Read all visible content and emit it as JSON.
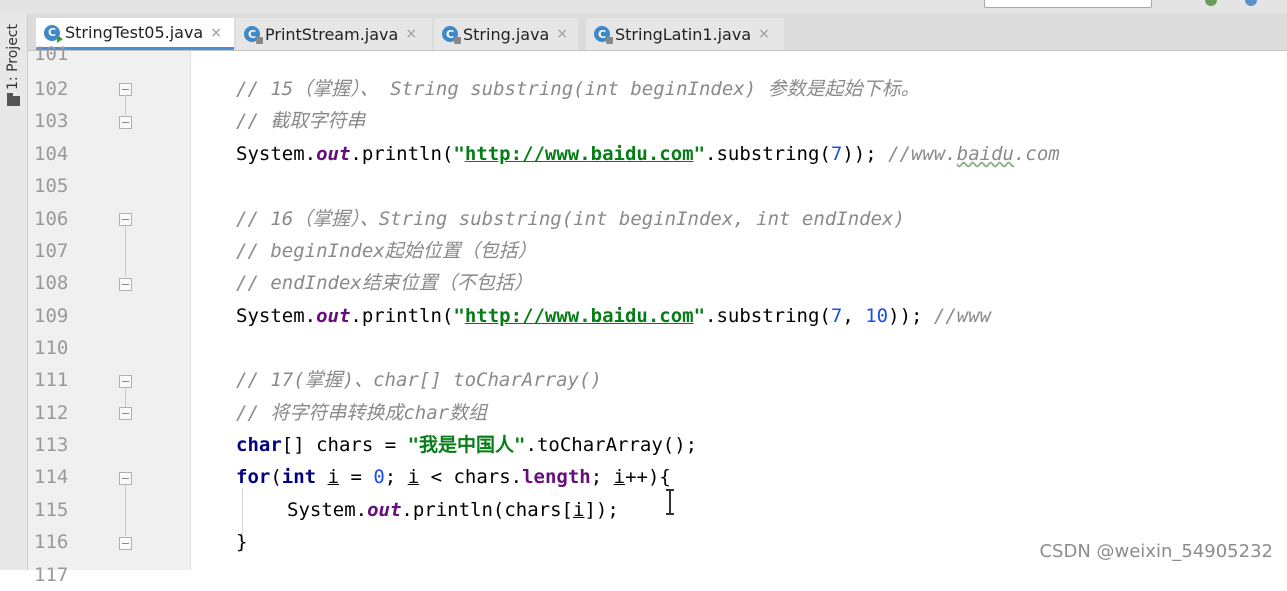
{
  "tool_window": {
    "project_label": "1: Project"
  },
  "tabs": [
    {
      "label": "StringTest05.java",
      "icon": "java-class-runnable-icon",
      "active": true
    },
    {
      "label": "PrintStream.java",
      "icon": "java-class-library-icon",
      "active": false
    },
    {
      "label": "String.java",
      "icon": "java-class-library-icon",
      "active": false
    },
    {
      "label": "StringLatin1.java",
      "icon": "java-class-library-icon",
      "active": false
    }
  ],
  "tab_close_glyph": "×",
  "line_numbers": [
    "101",
    "102",
    "103",
    "104",
    "105",
    "106",
    "107",
    "108",
    "109",
    "110",
    "111",
    "112",
    "113",
    "114",
    "115",
    "116",
    "117"
  ],
  "code": {
    "l102": "// 15（掌握）、 String substring(int beginIndex) 参数是起始下标。",
    "l103": "// 截取字符串",
    "l104": {
      "a": "System.",
      "b": "out",
      "c": ".println(",
      "d": "\"",
      "e": "http://www.baidu.com",
      "f": "\"",
      "g": ".substring(",
      "h": "7",
      "i": ")); ",
      "j": "//www.",
      "k": "baidu",
      "l": ".com"
    },
    "l106": "// 16（掌握）、String substring(int beginIndex, int endIndex)",
    "l107": "// beginIndex起始位置（包括）",
    "l108": "// endIndex结束位置（不包括）",
    "l109": {
      "a": "System.",
      "b": "out",
      "c": ".println(",
      "d": "\"",
      "e": "http://www.baidu.com",
      "f": "\"",
      "g": ".substring(",
      "h": "7",
      "i": ", ",
      "j": "10",
      "k": ")); ",
      "l": "//www"
    },
    "l111": "// 17(掌握)、char[] toCharArray()",
    "l112": "// 将字符串转换成char数组",
    "l113": {
      "a": "char",
      "b": "[] chars = ",
      "c": "\"我是中国人\"",
      "d": ".toCharArray();"
    },
    "l114": {
      "a": "for",
      "b": "(",
      "c": "int",
      "d": " ",
      "e": "i",
      "f": " = ",
      "g": "0",
      "h": "; ",
      "i": "i",
      "j": " < chars.",
      "k": "length",
      "l": "; ",
      "m": "i",
      "n": "++){"
    },
    "l115": {
      "a": "System.",
      "b": "out",
      "c": ".println(chars[",
      "d": "i",
      "e": "]);"
    },
    "l116": "}"
  },
  "watermark": "CSDN @weixin_54905232",
  "colors": {
    "keyword": "#000080",
    "string": "#067d17",
    "comment": "#8a8a8a",
    "field": "#660e7a",
    "number": "#1750eb",
    "active_tab_underline": "#4a8ed8"
  }
}
